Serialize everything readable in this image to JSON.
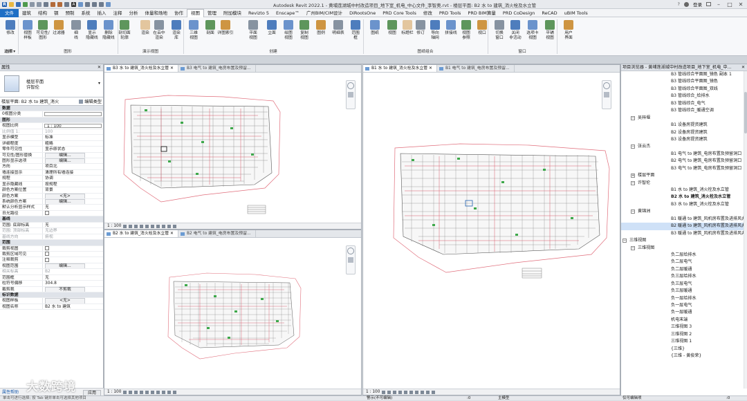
{
  "titlebar": {
    "title": "Autodesk Revit 2022.1 - 黄埔莲湖城中村改造项目_地下室_机电_中心文件_李智奥.rvt - 楼层平面: B2 水 to 建筑_消火栓及水立管",
    "user": "登录",
    "help": "?"
  },
  "menu": {
    "tabs": [
      "文件",
      "建筑",
      "结构",
      "钢",
      "预制",
      "系统",
      "插入",
      "注释",
      "分析",
      "体量和场地",
      "协作",
      "视图",
      "管理",
      "附加模块",
      "Revizto 5",
      "Enscape™",
      "广州BIM/CIM设计",
      "DiRootsOne",
      "PRD Core Tools",
      "修改",
      "PRD Tools",
      "PRD BIM算量",
      "PRD CoDesign",
      "ReCAD",
      "uBIM Tools"
    ],
    "active": "视图"
  },
  "ribbon": {
    "buttons": [
      {
        "label": "修改",
        "icon": "cursor-icon"
      },
      {
        "label": "视图\n样板",
        "icon": "view-template-icon"
      },
      {
        "label": "可见性/\n图形",
        "icon": "visibility-icon"
      },
      {
        "label": "过滤器",
        "icon": "filter-icon"
      },
      {
        "label": "细\n线",
        "icon": "thin-lines-icon"
      },
      {
        "label": "显示\n隐藏线",
        "icon": "show-hidden-icon"
      },
      {
        "label": "删除\n隐藏线",
        "icon": "remove-hidden-icon"
      },
      {
        "label": "剖切面\n轮廓",
        "icon": "cut-profile-icon"
      },
      {
        "label": "渲染",
        "icon": "render-icon"
      },
      {
        "label": "在云中\n渲染",
        "icon": "cloud-render-icon"
      },
      {
        "label": "渲染\n库",
        "icon": "render-gallery-icon"
      },
      {
        "label": "三维\n视图",
        "icon": "3d-view-icon"
      },
      {
        "label": "剖面",
        "icon": "section-icon"
      },
      {
        "label": "详图索引",
        "icon": "callout-icon"
      },
      {
        "label": "平面\n视图",
        "icon": "plan-view-icon"
      },
      {
        "label": "立面",
        "icon": "elevation-icon"
      },
      {
        "label": "绘图\n视图",
        "icon": "drafting-view-icon"
      },
      {
        "label": "复制\n视图",
        "icon": "duplicate-view-icon"
      },
      {
        "label": "图例",
        "icon": "legend-icon"
      },
      {
        "label": "明细表",
        "icon": "schedule-icon"
      },
      {
        "label": "范围\n框",
        "icon": "scope-box-icon"
      },
      {
        "label": "图纸",
        "icon": "sheet-icon"
      },
      {
        "label": "视图",
        "icon": "view-icon"
      },
      {
        "label": "标题栏",
        "icon": "title-block-icon"
      },
      {
        "label": "修订",
        "icon": "revision-icon"
      },
      {
        "label": "导向\n轴网",
        "icon": "guide-grid-icon"
      },
      {
        "label": "拼接线",
        "icon": "matchline-icon"
      },
      {
        "label": "视图\n参照",
        "icon": "view-reference-icon"
      },
      {
        "label": "视口",
        "icon": "viewport-icon"
      },
      {
        "label": "切换\n窗口",
        "icon": "switch-windows-icon"
      },
      {
        "label": "关闭\n非活动",
        "icon": "close-inactive-icon"
      },
      {
        "label": "选项卡\n视图",
        "icon": "tab-views-icon"
      },
      {
        "label": "平铺\n视图",
        "icon": "tile-views-icon"
      },
      {
        "label": "用户\n界面",
        "icon": "user-interface-icon"
      }
    ],
    "groups": [
      "选择",
      "图形",
      "演示视图",
      "创建",
      "图纸组合",
      "窗口"
    ],
    "select_label": "选择 ▾"
  },
  "properties": {
    "header": "属性",
    "type_name": "楼层平面\n许智伦",
    "selector": "楼层平面: B2 水 to 建筑_消火",
    "edit_type": "编辑类型",
    "rows": [
      {
        "k": "数据",
        "v": "",
        "sec": true
      },
      {
        "k": "0视图分类",
        "v": "",
        "box": true
      },
      {
        "k": "图形",
        "v": "",
        "sec": true
      },
      {
        "k": "视图比例",
        "v": "1 : 100",
        "box": true
      },
      {
        "k": "比例值 1:",
        "v": "100",
        "dim": true
      },
      {
        "k": "显示模型",
        "v": "标准"
      },
      {
        "k": "详细程度",
        "v": "粗略"
      },
      {
        "k": "零件可见性",
        "v": "显示原状态"
      },
      {
        "k": "可见性/图形替换",
        "v": "编辑...",
        "btn": true
      },
      {
        "k": "图形显示选项",
        "v": "编辑...",
        "btn": true
      },
      {
        "k": "方向",
        "v": "项目北"
      },
      {
        "k": "墙连接显示",
        "v": "清理所有墙连接"
      },
      {
        "k": "规程",
        "v": "协调"
      },
      {
        "k": "显示隐藏线",
        "v": "按规程"
      },
      {
        "k": "颜色方案位置",
        "v": "背景"
      },
      {
        "k": "颜色方案",
        "v": "<无>",
        "btn": true
      },
      {
        "k": "系统颜色方案",
        "v": "编辑...",
        "btn": true
      },
      {
        "k": "默认分析显示样式",
        "v": "无"
      },
      {
        "k": "日光路径",
        "v": "",
        "cb": true
      },
      {
        "k": "基线",
        "v": "",
        "sec": true
      },
      {
        "k": "范围: 底部标高",
        "v": "无"
      },
      {
        "k": "范围: 顶部标高",
        "v": "无边界",
        "dim": true
      },
      {
        "k": "基线方向",
        "v": "俯视",
        "dim": true
      },
      {
        "k": "范围",
        "v": "",
        "sec": true
      },
      {
        "k": "裁剪视图",
        "v": "",
        "cb": true
      },
      {
        "k": "裁剪区域可见",
        "v": "",
        "cb": true
      },
      {
        "k": "注释裁剪",
        "v": "",
        "cb": true
      },
      {
        "k": "视图范围",
        "v": "编辑...",
        "btn": true
      },
      {
        "k": "相关标高",
        "v": "B2",
        "dim": true
      },
      {
        "k": "范围框",
        "v": "无"
      },
      {
        "k": "柱符号偏移",
        "v": "304.8"
      },
      {
        "k": "截剪裁",
        "v": "不剪裁",
        "btn": true
      },
      {
        "k": "标识数据",
        "v": "",
        "sec": true
      },
      {
        "k": "视图样板",
        "v": "<无>",
        "btn": true
      },
      {
        "k": "视图名称",
        "v": "B2 水 to 建筑"
      }
    ],
    "help_link": "属性帮助",
    "apply": "应用"
  },
  "views": {
    "top_left": {
      "tabs": [
        "B3 水 to 建筑_消火栓及水立管",
        "B3 电气 to 建筑_电房布置及预留..."
      ],
      "scale": "1 : 100"
    },
    "bottom_left": {
      "tabs": [
        "B2 水 to 建筑_消火栓及水立管",
        "B2 电气 to 建筑_电房布置及预留..."
      ],
      "scale": "1 : 100"
    },
    "right": {
      "tabs": [
        "B1 水 to 建筑_消火栓及水立管",
        "B1 电气 to 建筑_电房布置及预留..."
      ],
      "scale": "1 : 100"
    }
  },
  "browser": {
    "header": "项目浏览器 - 黄埔莲湖城中村改造项目_地下室_机电_中...",
    "items": [
      {
        "t": "B3 管线综合平面图_镜色 副本 1",
        "lv": 5
      },
      {
        "t": "B3 管线综合平面图_镜色",
        "lv": 5
      },
      {
        "t": "B3 管线综合平面图_双线",
        "lv": 5
      },
      {
        "t": "B3 管线综合_给排水",
        "lv": 5
      },
      {
        "t": "B3 管线综合_电气",
        "lv": 5
      },
      {
        "t": "B3 管线综合_暖通空调",
        "lv": 5
      },
      {
        "t": "吴梓堰",
        "lv": 4,
        "tg": "-"
      },
      {
        "t": "B1 设备房提资建筑",
        "lv": 5
      },
      {
        "t": "B2 设备房提资建筑",
        "lv": 5
      },
      {
        "t": "B3 设备房提资建筑",
        "lv": 5
      },
      {
        "t": "张云杰",
        "lv": 4,
        "tg": "-"
      },
      {
        "t": "B1 电气 to 建筑_电房布置及预留洞口",
        "lv": 5
      },
      {
        "t": "B2 电气 to 建筑_电房布置及预留洞口",
        "lv": 5
      },
      {
        "t": "B3 电气 to 建筑_电房布置及预留洞口",
        "lv": 5
      },
      {
        "t": "楼层平面",
        "lv": 4,
        "tg": "+"
      },
      {
        "t": "许智伦",
        "lv": 4,
        "tg": "-"
      },
      {
        "t": "B1 水 to 建筑_消火栓及水立管",
        "lv": 5
      },
      {
        "t": "B2 水 to 建筑_消火栓及水立管",
        "lv": 5,
        "bold": true
      },
      {
        "t": "B3 水 to 建筑_消火栓及水立管",
        "lv": 5
      },
      {
        "t": "黄锦洲",
        "lv": 4,
        "tg": "-"
      },
      {
        "t": "B1 暖通 to 建筑_风机房布置及进排风井",
        "lv": 5
      },
      {
        "t": "B2 暖通 to 建筑_风机房布置及进排风井",
        "lv": 5,
        "sel": true
      },
      {
        "t": "B3 暖通 to 建筑_风机房布置及进排风井",
        "lv": 5
      },
      {
        "t": "三维视图",
        "lv": 3,
        "tg": "-"
      },
      {
        "t": "三维视图",
        "lv": 4,
        "tg": "-"
      },
      {
        "t": "负二层给排水",
        "lv": 5
      },
      {
        "t": "负二层电气",
        "lv": 5
      },
      {
        "t": "负二层暖通",
        "lv": 5
      },
      {
        "t": "负三层给排水",
        "lv": 5
      },
      {
        "t": "负三层电气",
        "lv": 5
      },
      {
        "t": "负三层暖通",
        "lv": 5
      },
      {
        "t": "负一层给排水",
        "lv": 5
      },
      {
        "t": "负一层电气",
        "lv": 5
      },
      {
        "t": "负一层暖通",
        "lv": 5
      },
      {
        "t": "机电末端",
        "lv": 5
      },
      {
        "t": "三维视图 3",
        "lv": 5
      },
      {
        "t": "三维视图 2",
        "lv": 5
      },
      {
        "t": "三维视图 1",
        "lv": 5
      },
      {
        "t": "{三维}",
        "lv": 5
      },
      {
        "t": "{三维 - 黄俊荣}",
        "lv": 5
      }
    ]
  },
  "statusbar": {
    "left": "单击可进行选择; 按 Tab 键并单击可选择其他项目",
    "workset": "警示(不可编辑)",
    "model": "主模型",
    "zero": ":0",
    "editable_only": "仅可编辑项",
    "zero2": ":0"
  },
  "watermark": "大数跨境"
}
